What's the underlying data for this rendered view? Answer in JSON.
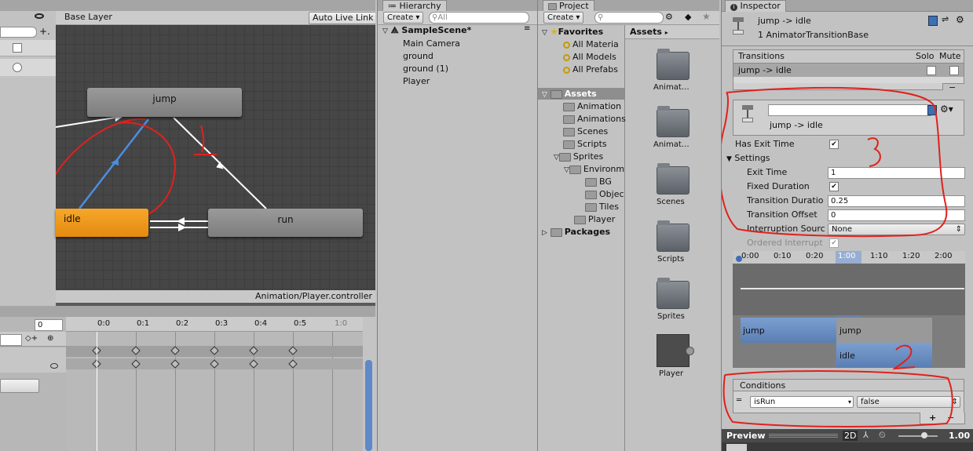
{
  "animator": {
    "layer_tab": "Base Layer",
    "auto_live_link": "Auto Live Link",
    "states": {
      "jump": "jump",
      "idle": "idle",
      "run": "run"
    },
    "path": "Animation/Player.controller",
    "annotation": "1"
  },
  "timeline": {
    "frame_value": "0",
    "ticks": [
      "0:0",
      "0:1",
      "0:2",
      "0:3",
      "0:4",
      "0:5",
      "1:0"
    ]
  },
  "hierarchy": {
    "tab": "Hierarchy",
    "create": "Create",
    "search_placeholder": "All",
    "scene": "SampleScene*",
    "items": [
      "Main Camera",
      "ground",
      "ground (1)",
      "Player"
    ]
  },
  "project": {
    "tab": "Project",
    "create": "Create",
    "favorites_label": "Favorites",
    "favorites": [
      "All Materia",
      "All Models",
      "All Prefabs"
    ],
    "assets_label": "Assets",
    "folders": [
      "Animation",
      "Animations",
      "Scenes",
      "Scripts",
      "Sprites",
      "Environm",
      "BG",
      "Objec",
      "Tiles",
      "Player"
    ],
    "packages_label": "Packages",
    "breadcrumb": "Assets",
    "grid_items": [
      "Animat…",
      "Animat…",
      "Scenes",
      "Scripts",
      "Sprites",
      "Player"
    ]
  },
  "inspector": {
    "tab": "Inspector",
    "title": "jump -> idle",
    "subtitle": "1 AnimatorTransitionBase",
    "transitions_header": "Transitions",
    "solo": "Solo",
    "mute": "Mute",
    "transition_row": "jump -> idle",
    "minus_btn": "−",
    "detail_name": "jump -> idle",
    "has_exit_time": "Has Exit Time",
    "settings": "Settings",
    "fields": [
      {
        "label": "Exit Time",
        "value": "1"
      },
      {
        "label": "Fixed Duration",
        "value": ""
      },
      {
        "label": "Transition Duratio",
        "value": "0.25"
      },
      {
        "label": "Transition Offset",
        "value": "0"
      },
      {
        "label": "Interruption Sourc",
        "value": "None"
      },
      {
        "label": "Ordered Interrupt",
        "value": ""
      }
    ],
    "timeline_ticks": [
      "0:00",
      "0:10",
      "0:20",
      "1:00",
      "1:10",
      "1:20",
      "2:00"
    ],
    "bar_jump1": "jump",
    "bar_jump2": "jump",
    "bar_idle": "idle",
    "conditions_header": "Conditions",
    "condition_param": "isRun",
    "condition_value": "false",
    "plus": "+",
    "minus": "−",
    "preview": "Preview",
    "preview_2d": "2D",
    "preview_speed": "1.00",
    "annot_2": "2",
    "annot_3": "3"
  },
  "colors": {
    "accent_blue": "#3d6fb6",
    "idle_orange": "#f0a020",
    "annotation_red": "#e0211d"
  }
}
